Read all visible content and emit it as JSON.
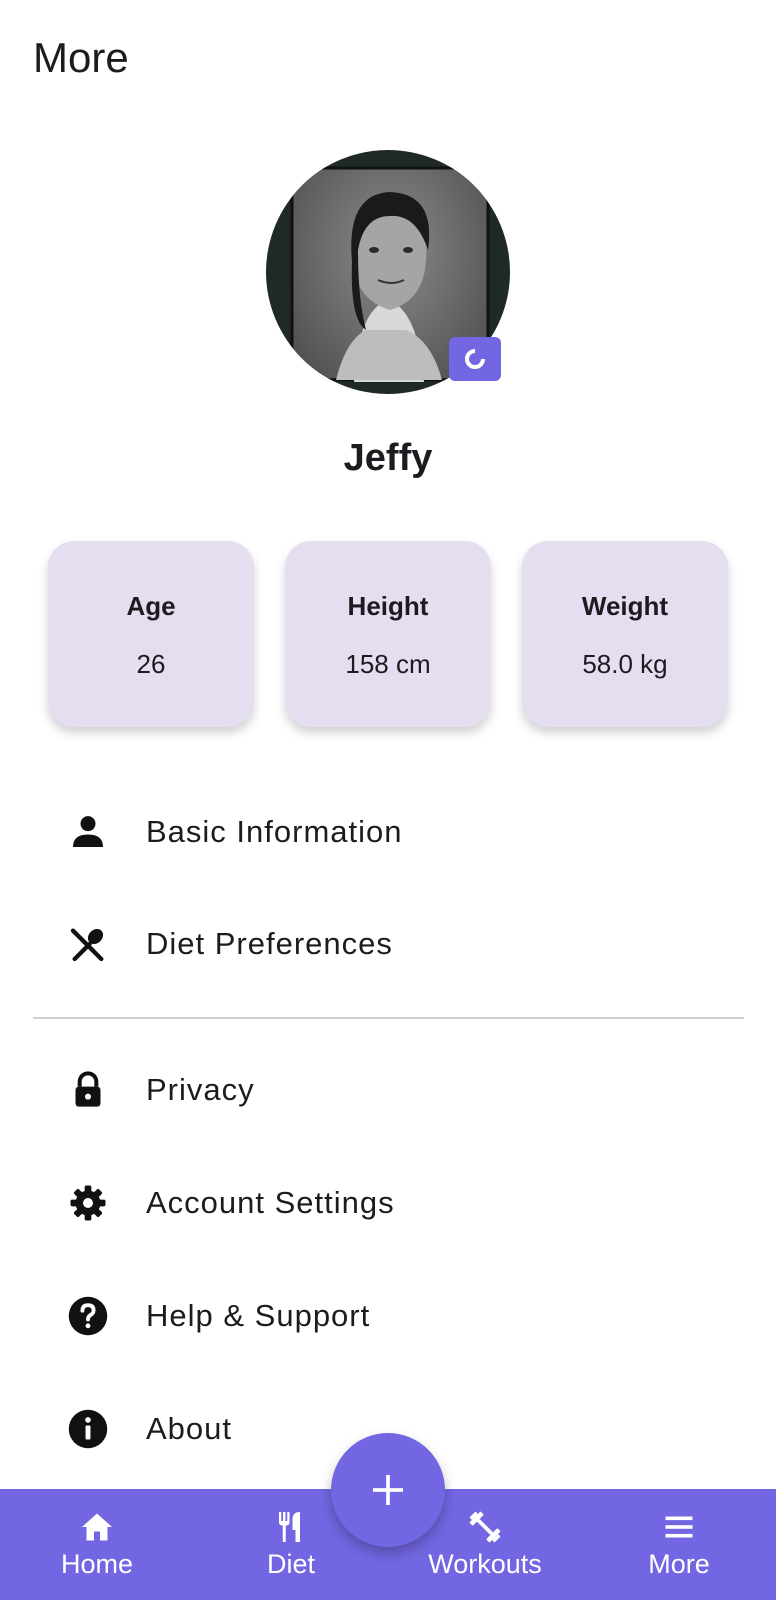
{
  "header": {
    "title": "More"
  },
  "profile": {
    "name": "Jeffy",
    "avatar_icon": "profile-photo",
    "camera_icon": "camera-icon"
  },
  "stats": [
    {
      "label": "Age",
      "value": "26"
    },
    {
      "label": "Height",
      "value": "158 cm"
    },
    {
      "label": "Weight",
      "value": "58.0 kg"
    }
  ],
  "menu": {
    "group1": [
      {
        "label": "Basic Information",
        "icon": "person-icon"
      },
      {
        "label": "Diet Preferences",
        "icon": "dining-icon"
      }
    ],
    "group2": [
      {
        "label": "Privacy",
        "icon": "lock-icon"
      },
      {
        "label": "Account Settings",
        "icon": "gear-icon"
      },
      {
        "label": "Help & Support",
        "icon": "help-icon"
      },
      {
        "label": "About",
        "icon": "info-icon"
      }
    ]
  },
  "bottom_nav": {
    "items": [
      {
        "label": "Home",
        "icon": "home-icon"
      },
      {
        "label": "Diet",
        "icon": "restaurant-icon"
      },
      {
        "label": "Workouts",
        "icon": "dumbbell-icon"
      },
      {
        "label": "More",
        "icon": "menu-icon"
      }
    ],
    "fab_icon": "plus-icon"
  },
  "colors": {
    "accent": "#7266e2",
    "card_bg": "#e4def0",
    "text": "#1d1b20",
    "divider": "#cfcfcf"
  }
}
